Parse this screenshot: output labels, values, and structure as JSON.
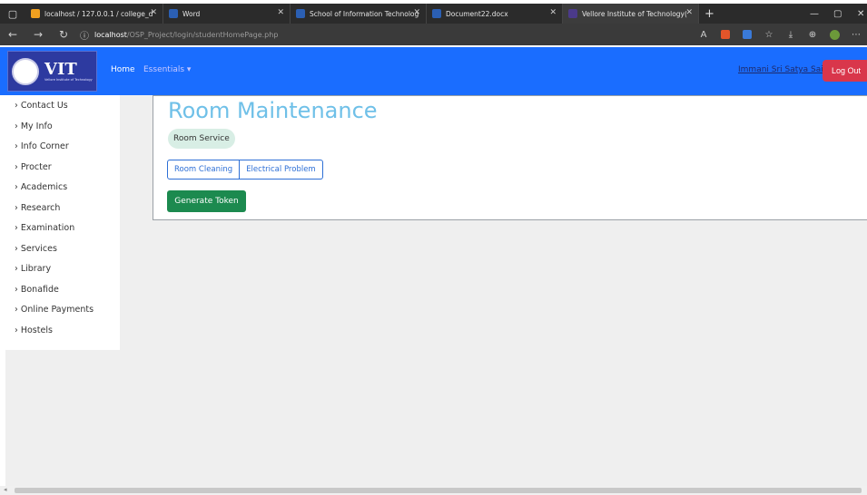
{
  "browser": {
    "tabs": [
      {
        "title": "localhost / 127.0.0.1 / college_d",
        "favicon_color": "#f0a020"
      },
      {
        "title": "Word",
        "favicon_color": "#2b5fb3"
      },
      {
        "title": "School of Information Technolog",
        "favicon_color": "#2b5fb3"
      },
      {
        "title": "Document22.docx",
        "favicon_color": "#2b5fb3"
      },
      {
        "title": "Vellore Institute of Technology(",
        "favicon_color": "#4b3a8a"
      }
    ],
    "new_tab": "+",
    "url_host": "localhost",
    "url_path": "/OSP_Project/login/studentHomePage.php"
  },
  "navbar": {
    "logo_text": "VIT",
    "logo_subtext": "Vellore Institute of Technology",
    "home": "Home",
    "essentials": "Essentials ▾",
    "user": "Immani Sri Satya Sai",
    "logout": "Log Out"
  },
  "sidebar": {
    "items": [
      {
        "label": "Contact Us"
      },
      {
        "label": "My Info"
      },
      {
        "label": "Info Corner"
      },
      {
        "label": "Procter"
      },
      {
        "label": "Academics"
      },
      {
        "label": "Research"
      },
      {
        "label": "Examination"
      },
      {
        "label": "Services"
      },
      {
        "label": "Library"
      },
      {
        "label": "Bonafide"
      },
      {
        "label": "Online Payments"
      },
      {
        "label": "Hostels"
      }
    ]
  },
  "main": {
    "title": "Room Maintenance",
    "badge": "Room Service",
    "options": [
      "Room Cleaning",
      "Electrical Problem"
    ],
    "generate": "Generate Token"
  },
  "colors": {
    "navbar": "#1a6dff",
    "title": "#6fc0e8",
    "logout": "#d9364b",
    "generate": "#1c8a4f",
    "outline": "#2d6fd6"
  }
}
